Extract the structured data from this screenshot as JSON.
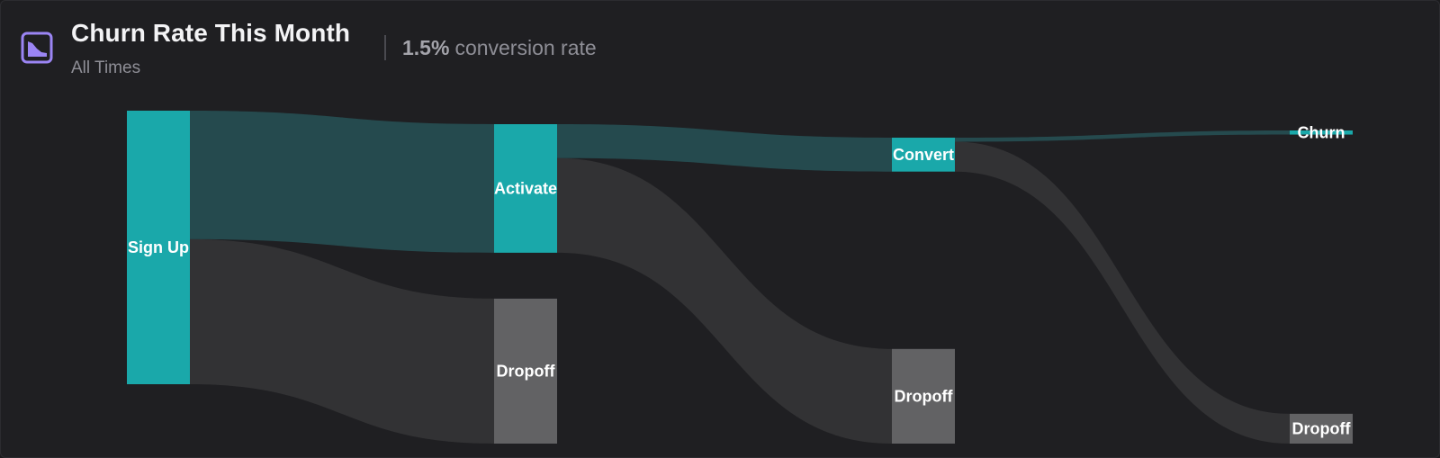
{
  "header": {
    "title": "Churn Rate This Month",
    "subtitle": "All Times",
    "conversion_value": "1.5%",
    "conversion_label": "conversion rate",
    "icon": "area-chart-icon"
  },
  "colors": {
    "accent": "#1aa8aa",
    "dropoff_node": "#626264",
    "flow_conversion": "#254a4e",
    "flow_dropoff": "#323234",
    "icon_purple": "#9b85f4"
  },
  "chart_data": {
    "type": "sankey",
    "nodes": [
      {
        "id": "signup",
        "label": "Sign Up",
        "stage": 0,
        "kind": "step"
      },
      {
        "id": "activate",
        "label": "Activate",
        "stage": 1,
        "kind": "step"
      },
      {
        "id": "dropoff1",
        "label": "Dropoff",
        "stage": 1,
        "kind": "dropoff"
      },
      {
        "id": "convert",
        "label": "Convert",
        "stage": 2,
        "kind": "step"
      },
      {
        "id": "dropoff2",
        "label": "Dropoff",
        "stage": 2,
        "kind": "dropoff"
      },
      {
        "id": "churn",
        "label": "Churn",
        "stage": 3,
        "kind": "step"
      },
      {
        "id": "dropoff3",
        "label": "Dropoff",
        "stage": 3,
        "kind": "dropoff"
      }
    ],
    "links": [
      {
        "source": "signup",
        "target": "activate",
        "value": 47,
        "kind": "conversion"
      },
      {
        "source": "signup",
        "target": "dropoff1",
        "value": 53,
        "kind": "dropoff"
      },
      {
        "source": "activate",
        "target": "convert",
        "value": 12.4,
        "kind": "conversion"
      },
      {
        "source": "activate",
        "target": "dropoff2",
        "value": 34.6,
        "kind": "dropoff"
      },
      {
        "source": "convert",
        "target": "churn",
        "value": 1.5,
        "kind": "conversion"
      },
      {
        "source": "convert",
        "target": "dropoff3",
        "value": 10.9,
        "kind": "dropoff"
      }
    ]
  }
}
